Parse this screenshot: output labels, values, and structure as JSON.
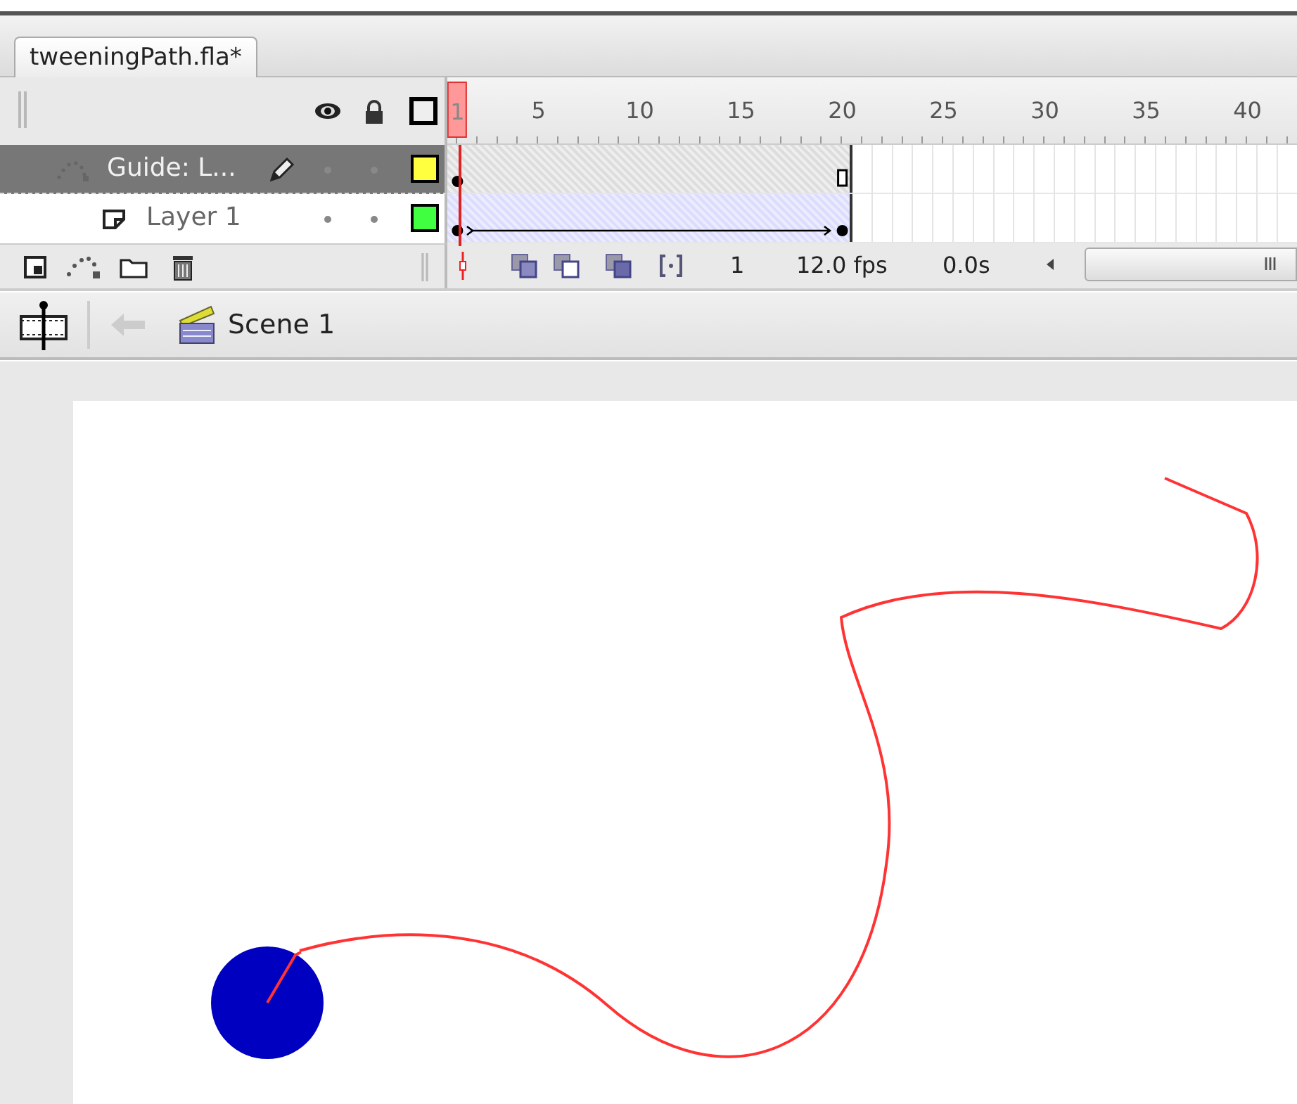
{
  "document_tab": {
    "title": "tweeningPath.fla*",
    "selected": true
  },
  "timeline": {
    "ruler": [
      {
        "label": "1",
        "selected": true
      },
      {
        "label": "5",
        "selected": false
      },
      {
        "label": "10",
        "selected": false
      },
      {
        "label": "15",
        "selected": false
      },
      {
        "label": "20",
        "selected": false
      },
      {
        "label": "25",
        "selected": false
      },
      {
        "label": "30",
        "selected": false
      },
      {
        "label": "35",
        "selected": false
      },
      {
        "label": "40",
        "selected": false
      }
    ],
    "layers": [
      {
        "name": "Guide: L...",
        "kind": "guide",
        "selected": true,
        "color": "#ffff40",
        "motion_tween": false
      },
      {
        "name": "Layer 1",
        "kind": "normal",
        "selected": false,
        "color": "#40ff40",
        "motion_tween": true
      }
    ],
    "current_frame": "1",
    "frame_rate": "12.0 fps",
    "elapsed_time": "0.0s"
  },
  "edit_bar": {
    "scene": "Scene 1"
  }
}
